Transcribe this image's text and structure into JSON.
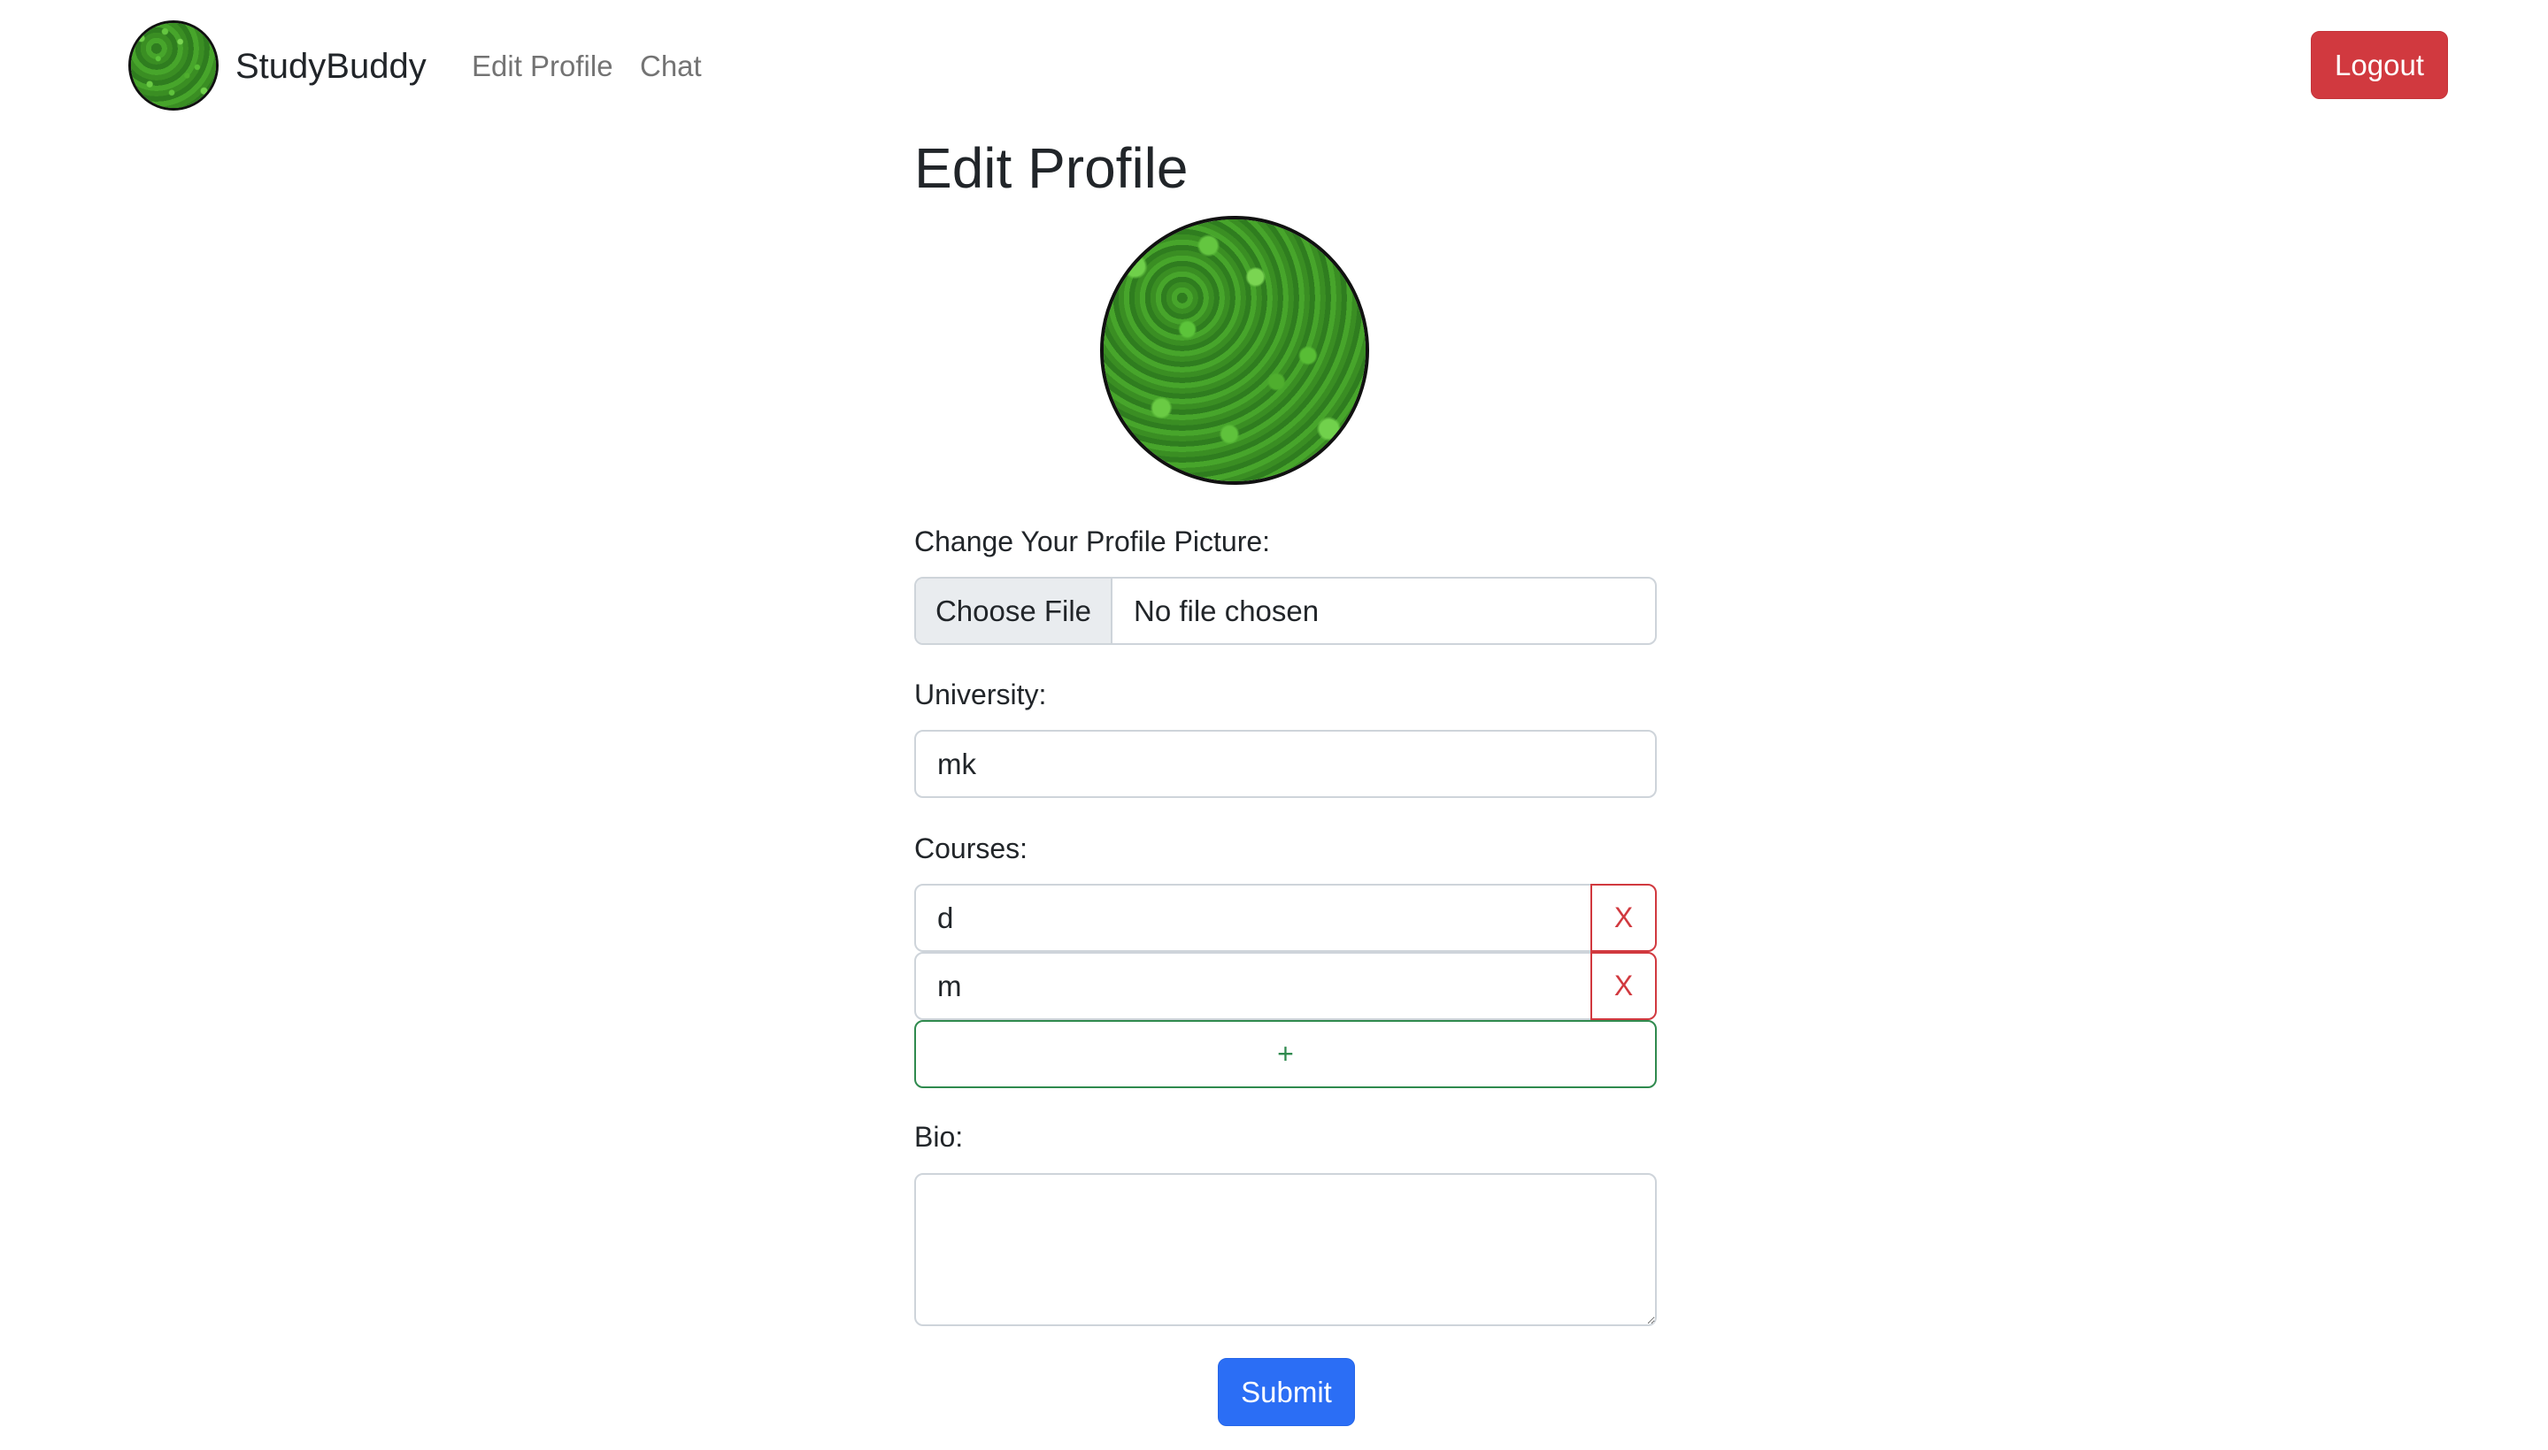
{
  "navbar": {
    "brand_name": "StudyBuddy",
    "links": [
      "Edit Profile",
      "Chat"
    ],
    "logout_label": "Logout"
  },
  "page": {
    "title": "Edit Profile"
  },
  "form": {
    "picture_label": "Change Your Profile Picture:",
    "file_button_label": "Choose File",
    "file_status": "No file chosen",
    "university_label": "University:",
    "university_value": "mk",
    "courses_label": "Courses:",
    "courses": [
      {
        "value": "d",
        "remove_label": "X"
      },
      {
        "value": "m",
        "remove_label": "X"
      }
    ],
    "add_course_label": "+",
    "bio_label": "Bio:",
    "bio_value": "",
    "submit_label": "Submit"
  },
  "colors": {
    "danger": "#d1393f",
    "success": "#2f8a4e",
    "primary": "#2b6ef5"
  },
  "icons": {
    "avatar": "leaf-texture-image"
  }
}
